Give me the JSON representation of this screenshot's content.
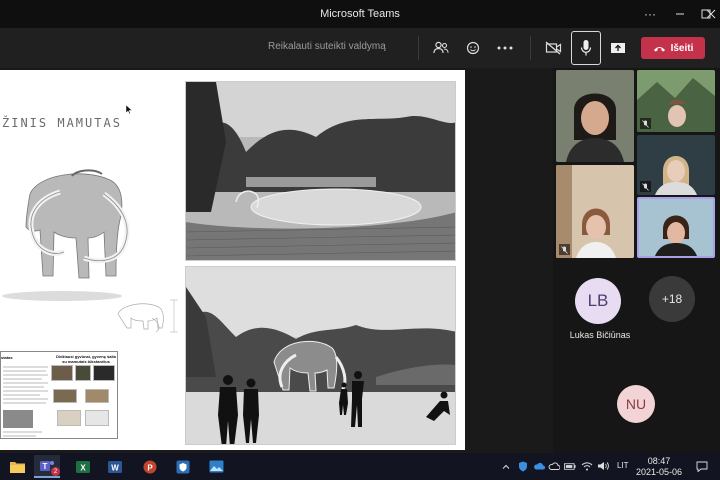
{
  "window": {
    "title": "Microsoft Teams"
  },
  "toolbar": {
    "request_control": "Reikalauti suteikti valdymą",
    "leave_label": "Išeiti"
  },
  "slide": {
    "title": "ŽINIS MAMUTAS",
    "info_left_heading": "statas",
    "info_right_heading": "Didžiausi gyvūnai, gyvenę šalia su mamutais tūkstančius"
  },
  "participants": {
    "avatar_initials": "LB",
    "avatar_name": "Lukas Bičiūnas",
    "more_count": "+18",
    "bottom_initials": "NU"
  },
  "taskbar": {
    "language": "LIT",
    "time": "08:47",
    "date": "2021-05-06",
    "teams_badge": "2"
  }
}
